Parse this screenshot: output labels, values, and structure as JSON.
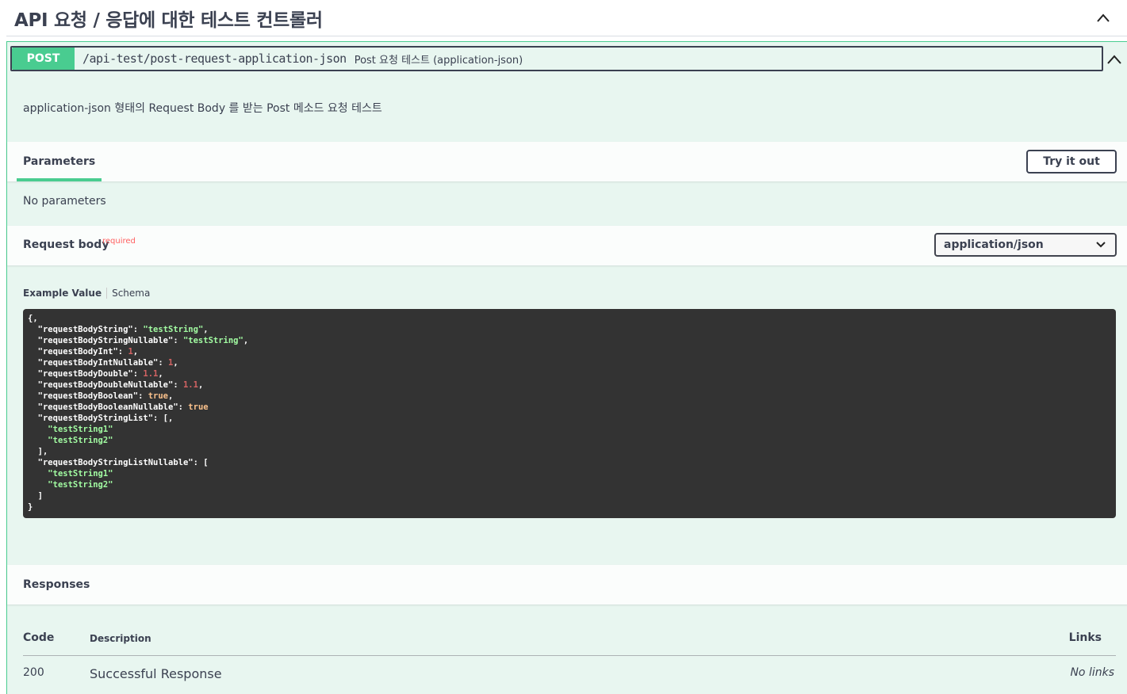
{
  "tag": {
    "title": "API 요청 / 응답에 대한 테스트 컨트롤러"
  },
  "operation": {
    "method": "POST",
    "path": "/api-test/post-request-application-json",
    "summary": "Post 요청 테스트 (application-json)",
    "description": "application-json 형태의 Request Body 를 받는 Post 메소드 요청 테스트"
  },
  "parameters": {
    "tab_label": "Parameters",
    "try_button": "Try it out",
    "empty_text": "No parameters"
  },
  "request_body": {
    "title": "Request body",
    "required_label": "required",
    "content_type": "application/json",
    "tab_example": "Example Value",
    "tab_schema": "Schema",
    "example_lines": [
      [
        "{",
        "",
        ""
      ],
      [
        "  \"requestBodyString\": ",
        "str",
        "\"testString\""
      ],
      [
        "  \"requestBodyStringNullable\": ",
        "str",
        "\"testString\""
      ],
      [
        "  \"requestBodyInt\": ",
        "num",
        "1"
      ],
      [
        "  \"requestBodyIntNullable\": ",
        "num",
        "1"
      ],
      [
        "  \"requestBodyDouble\": ",
        "num",
        "1.1"
      ],
      [
        "  \"requestBodyDoubleNullable\": ",
        "num",
        "1.1"
      ],
      [
        "  \"requestBodyBoolean\": ",
        "bool",
        "true"
      ],
      [
        "  \"requestBodyBooleanNullable\": ",
        "bool",
        "true"
      ],
      [
        "  \"requestBodyStringList\": [",
        "",
        ""
      ],
      [
        "    ",
        "str",
        "\"testString1\""
      ],
      [
        "    ",
        "str",
        "\"testString2\""
      ],
      [
        "  ],",
        "",
        ""
      ],
      [
        "  \"requestBodyStringListNullable\": [",
        "",
        ""
      ],
      [
        "    ",
        "str",
        "\"testString1\""
      ],
      [
        "    ",
        "str",
        "\"testString2\""
      ],
      [
        "  ]",
        "",
        ""
      ],
      [
        "}",
        "",
        ""
      ]
    ],
    "line_suffixes": [
      ",",
      ",",
      ",",
      ",",
      ",",
      ",",
      ",",
      ",",
      "",
      ",",
      "",
      "",
      "",
      "",
      "",
      "",
      "",
      ""
    ]
  },
  "responses": {
    "title": "Responses",
    "col_code": "Code",
    "col_description": "Description",
    "col_links": "Links",
    "rows": [
      {
        "code": "200",
        "description": "Successful Response",
        "links": "No links"
      }
    ]
  },
  "colors": {
    "post": "#49cc90",
    "post_bg": "#e8f6f0",
    "code_bg": "#333333"
  },
  "icons": {
    "tag_toggle": "chevron-up-icon",
    "summary_toggle": "chevron-up-icon",
    "select": "chevron-down-icon"
  }
}
